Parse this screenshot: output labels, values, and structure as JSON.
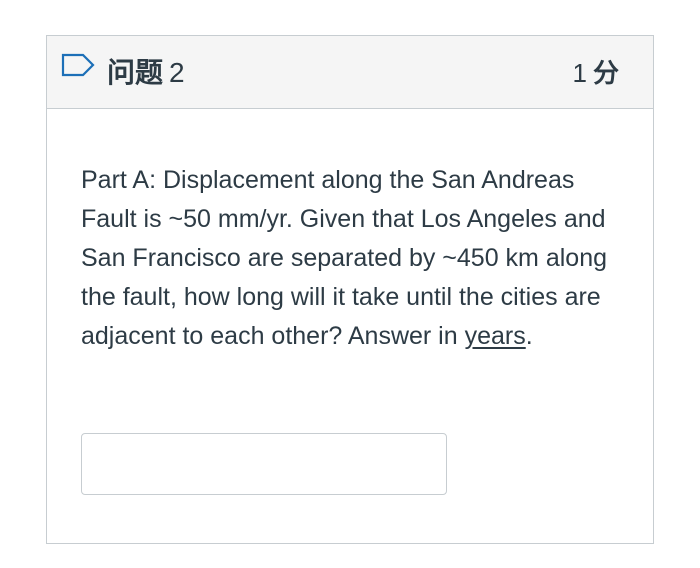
{
  "header": {
    "flag_icon": "flag-outline-icon",
    "question_label": "问题",
    "question_number": "2",
    "points_value": "1",
    "points_unit": "分"
  },
  "question": {
    "part_label": "Part A",
    "text_before": ": Displacement along the San Andreas Fault is ~50 mm/yr.  Given that Los Angeles and San Francisco are separated by ~450 km along the fault, how long will it take until the cities are adjacent to each other? Answer in ",
    "unit_underlined": "years",
    "text_after": "."
  },
  "answer": {
    "value": "",
    "placeholder": ""
  },
  "colors": {
    "border": "#c7cdd1",
    "header_bg": "#f5f5f5",
    "text": "#2d3b45",
    "flag_stroke": "#1c6fb7"
  }
}
